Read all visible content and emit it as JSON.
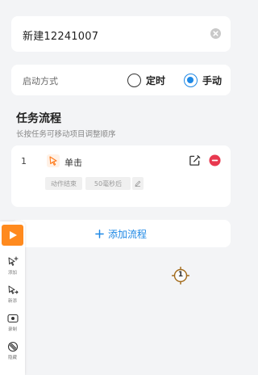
{
  "task": {
    "name": "新建12241007"
  },
  "start_mode": {
    "label": "启动方式",
    "options": [
      {
        "label": "定时",
        "selected": false
      },
      {
        "label": "手动",
        "selected": true
      }
    ],
    "accent_color": "#1e88e5"
  },
  "flow": {
    "title": "任务流程",
    "hint": "长按任务可移动项目调整顺序",
    "steps": [
      {
        "index": "1",
        "icon": "tap-icon",
        "name": "单击",
        "chips": [
          "动作结束",
          "50毫秒后"
        ]
      }
    ],
    "add_label": "添加流程"
  },
  "toolbar": {
    "play_color": "#ff8a1e",
    "items": [
      {
        "icon": "add-tap-icon",
        "label": "添加"
      },
      {
        "icon": "swipe-icon",
        "label": "新添"
      },
      {
        "icon": "record-icon",
        "label": "录制"
      },
      {
        "icon": "hide-icon",
        "label": "隐藏"
      }
    ]
  },
  "target_marker": {
    "number": "1"
  }
}
